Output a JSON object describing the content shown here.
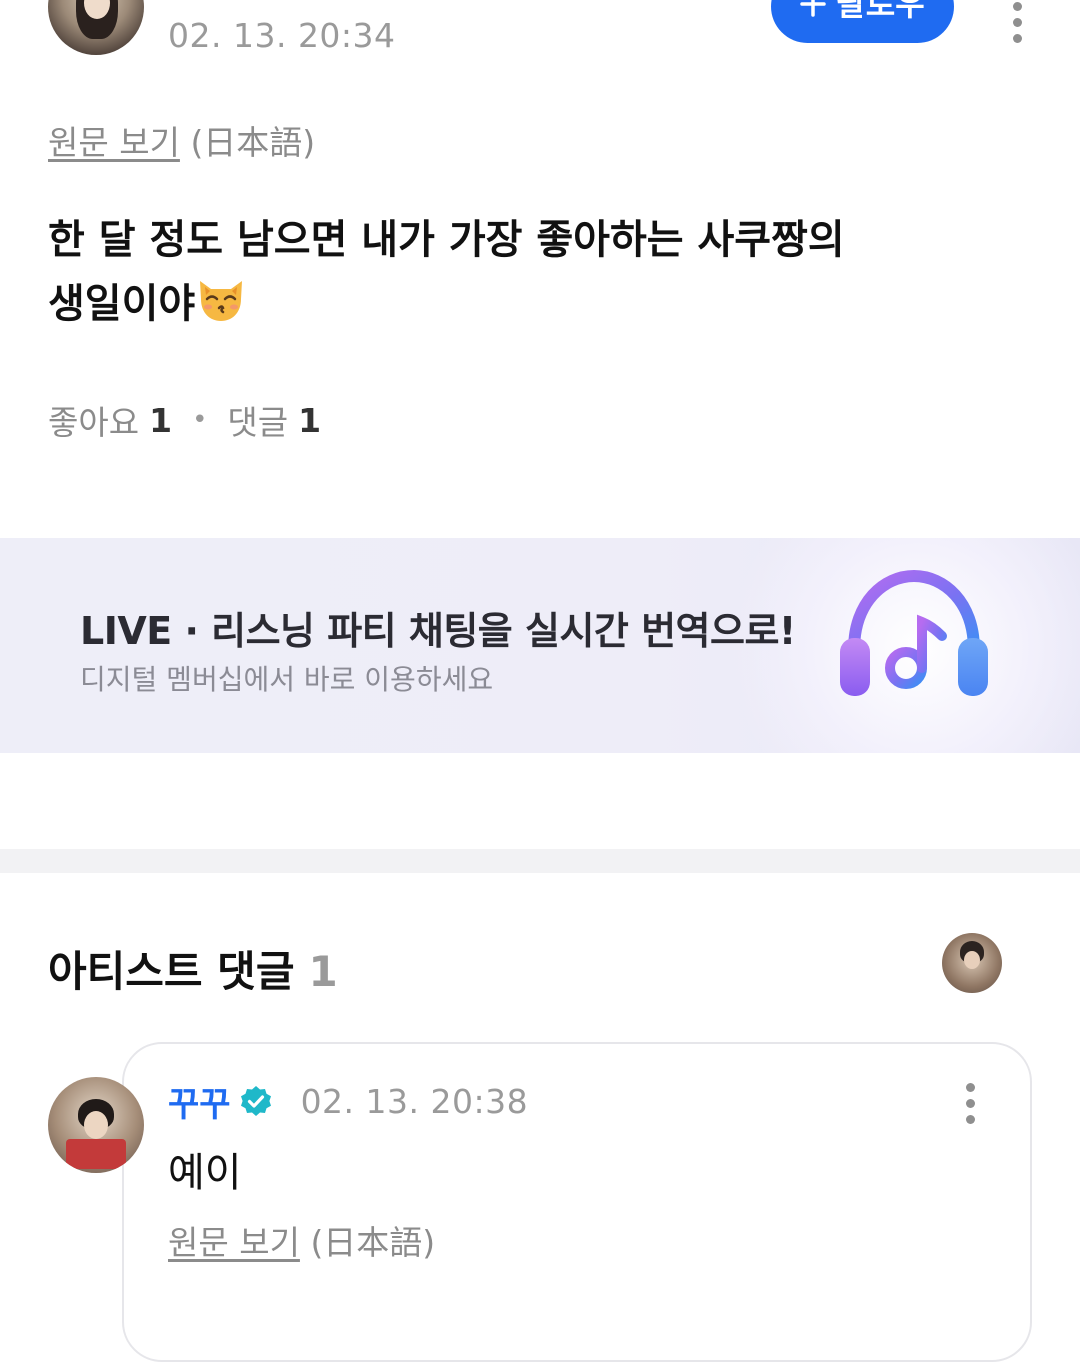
{
  "post": {
    "timestamp": "02. 13. 20:34",
    "follow_label": "팔로우",
    "follow_icon": "plus-icon",
    "original_link": "원문 보기",
    "original_lang": "(日本語)",
    "body_line1": "한 달 정도 남으면 내가 가장 좋아하는 사쿠짱의",
    "body_line2": "생일이야",
    "body_emoji": "kissing-cat-emoji",
    "likes_label": "좋아요",
    "likes_count": "1",
    "comments_label": "댓글",
    "comments_count": "1"
  },
  "banner": {
    "title": "LIVE · 리스닝 파티 채팅을 실시간 번역으로!",
    "subtitle": "디지털 멤버십에서 바로 이용하세요",
    "icon": "headphones-music-icon"
  },
  "artist_comments": {
    "title": "아티스트 댓글",
    "count": "1",
    "comment": {
      "author": "꾸꾸",
      "verified_icon": "verified-badge-icon",
      "timestamp": "02. 13. 20:38",
      "text": "예이",
      "original_link": "원문 보기",
      "original_lang": "(日本語)"
    }
  },
  "colors": {
    "accent": "#1f6bf1",
    "verified": "#1fb8c9",
    "banner_bg": "#eeeef8"
  }
}
